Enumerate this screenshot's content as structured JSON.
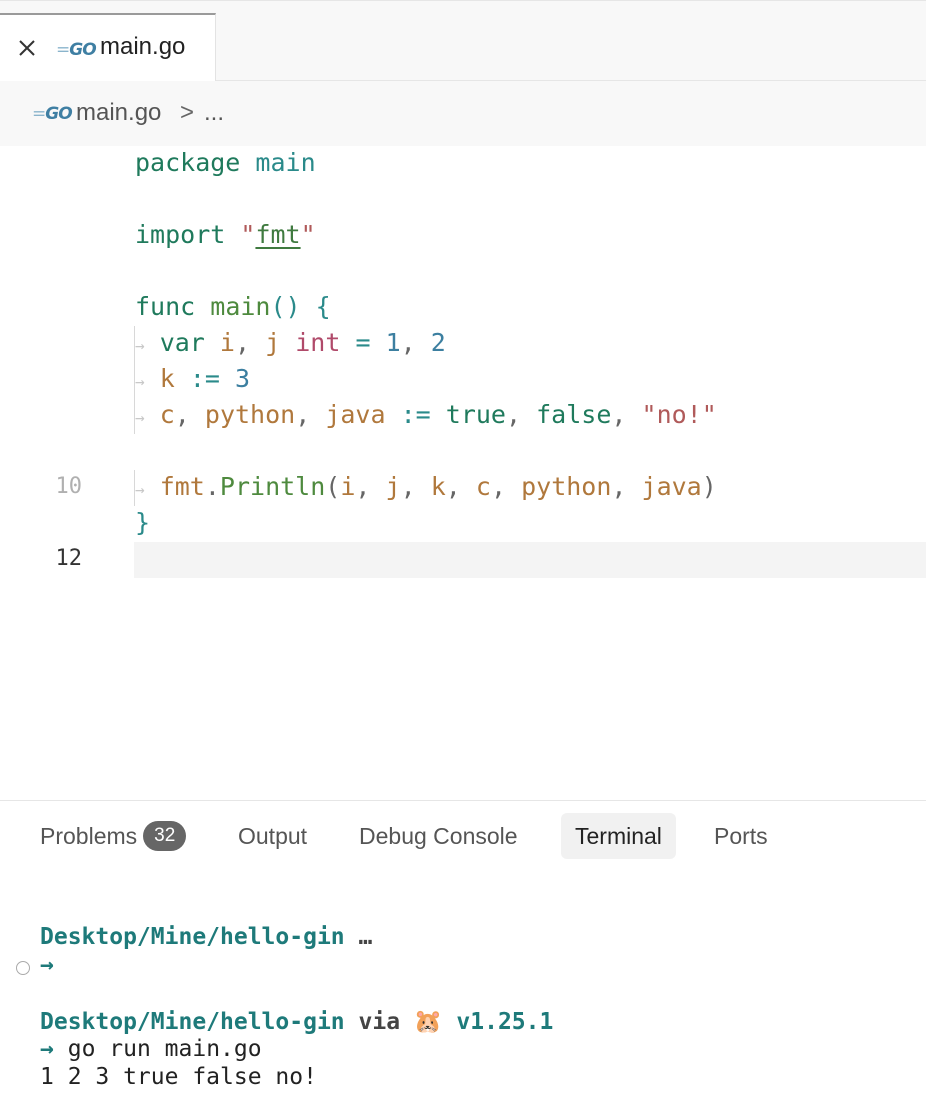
{
  "tab": {
    "label": "main.go",
    "go_icon": "GO"
  },
  "breadcrumb": {
    "file": "main.go",
    "separator": ">",
    "more": "..."
  },
  "editor": {
    "line_numbers": {
      "l10": "10",
      "l12": "12"
    },
    "lines": {
      "l1": {
        "kw": "package",
        "pkg": "main"
      },
      "l3": {
        "kw": "import",
        "q1": "\"",
        "str": "fmt",
        "q2": "\""
      },
      "l5": {
        "kw": "func",
        "fn": "main",
        "paren": "()",
        "brace": "{"
      },
      "l6": {
        "kw": "var",
        "i": "i",
        "c1": ",",
        "j": "j",
        "ty": "int",
        "eq": "=",
        "n1": "1",
        "c2": ",",
        "n2": "2"
      },
      "l7": {
        "k": "k",
        "op": ":=",
        "n": "3"
      },
      "l8": {
        "c": "c",
        "c1": ",",
        "python": "python",
        "c2": ",",
        "java": "java",
        "op": ":=",
        "t": "true",
        "c3": ",",
        "f": "false",
        "c4": ",",
        "s": "\"no!\""
      },
      "l10": {
        "pkg": "fmt",
        "dot": ".",
        "fn": "Println",
        "open": "(",
        "i": "i",
        "j": "j",
        "k": "k",
        "c": "c",
        "python": "python",
        "java": "java",
        "close": ")",
        "comma": ","
      },
      "l11": {
        "brace": "}"
      }
    }
  },
  "panel": {
    "tabs": {
      "problems": "Problems",
      "problems_count": "32",
      "output": "Output",
      "debug": "Debug Console",
      "terminal": "Terminal",
      "ports": "Ports"
    },
    "terminal": {
      "path1": "Desktop/Mine/hello-gin",
      "ellipsis": "…",
      "prompt1": "→",
      "path2": "Desktop/Mine/hello-gin",
      "via": "via",
      "emoji": "🐹",
      "version": "v1.25.1",
      "prompt2": "→",
      "command": "go run main.go",
      "output": "1 2 3 true false no!"
    }
  }
}
